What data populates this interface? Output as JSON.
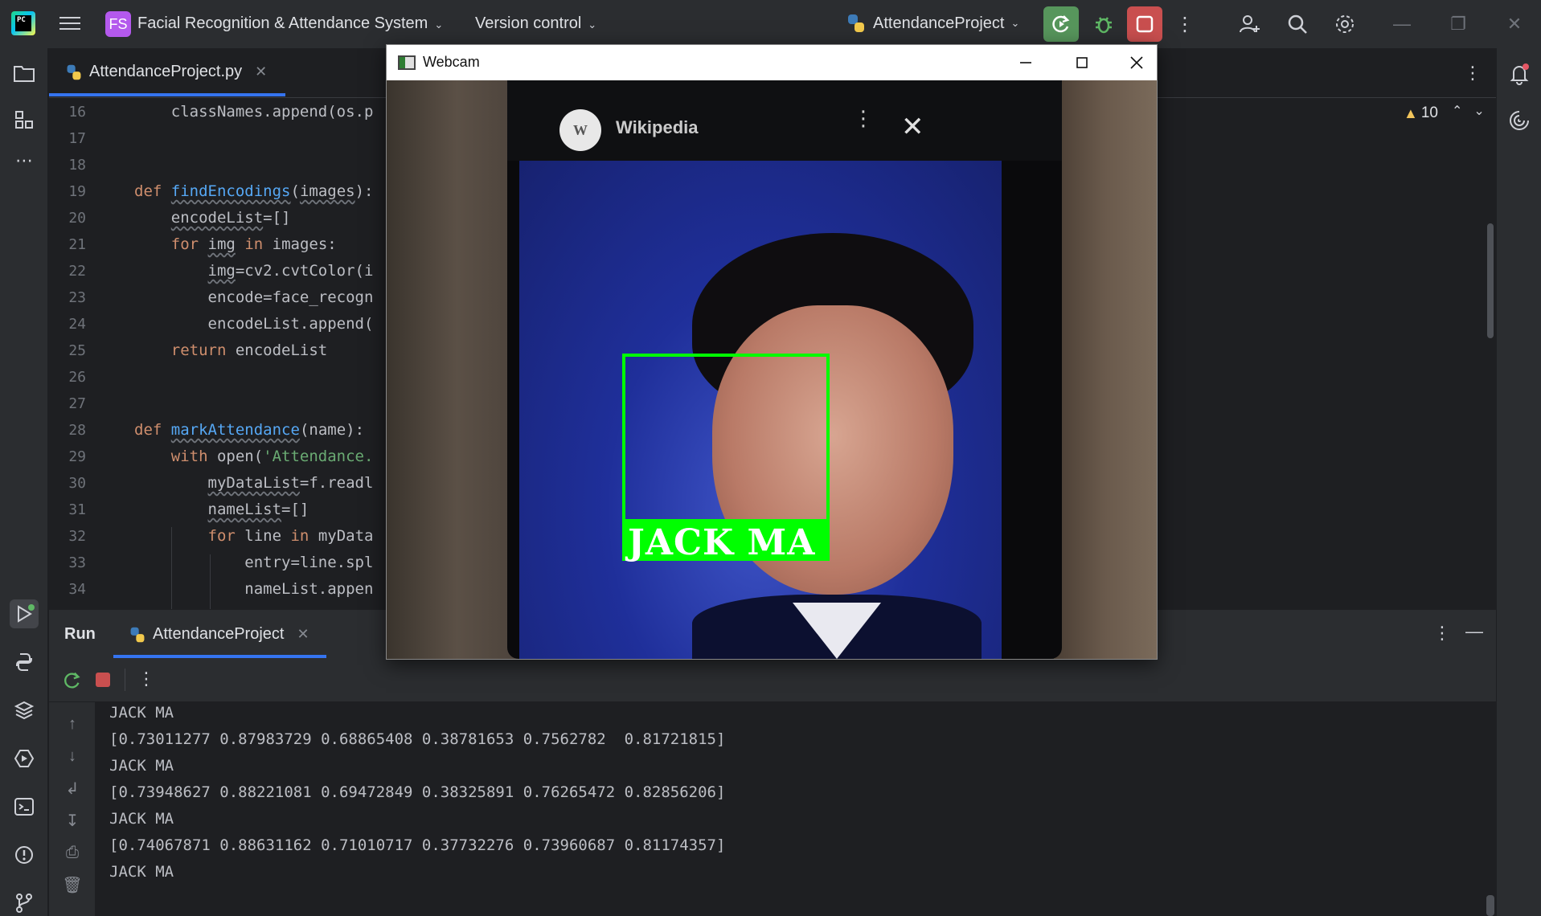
{
  "titlebar": {
    "project_badge": "FS",
    "project_name": "Facial Recognition & Attendance System",
    "version_control": "Version control",
    "run_config": "AttendanceProject"
  },
  "editor": {
    "tab_label": "AttendanceProject.py",
    "warnings_count": "10",
    "line_numbers": [
      "16",
      "17",
      "18",
      "19",
      "20",
      "21",
      "22",
      "23",
      "24",
      "25",
      "26",
      "27",
      "28",
      "29",
      "30",
      "31",
      "32",
      "33",
      "34"
    ]
  },
  "run": {
    "title": "Run",
    "tab_label": "AttendanceProject",
    "console_lines": [
      "JACK MA",
      "[0.73011277 0.87983729 0.68865408 0.38781653 0.7562782  0.81721815]",
      "JACK MA",
      "[0.73948627 0.88221081 0.69472849 0.38325891 0.76265472 0.82856206]",
      "JACK MA",
      "[0.74067871 0.88631162 0.71010717 0.37732276 0.73960687 0.81174357]",
      "JACK MA"
    ]
  },
  "webcam": {
    "title": "Webcam",
    "page_name": "Wikipedia",
    "detected_name": "JACK MA",
    "box_color": "#00ff00"
  },
  "colors": {
    "accent": "#3574f0",
    "run_green": "#57965c",
    "stop_red": "#c94f4f",
    "keyword": "#cf8e6d",
    "function": "#56a8f5",
    "string": "#6aab73"
  }
}
